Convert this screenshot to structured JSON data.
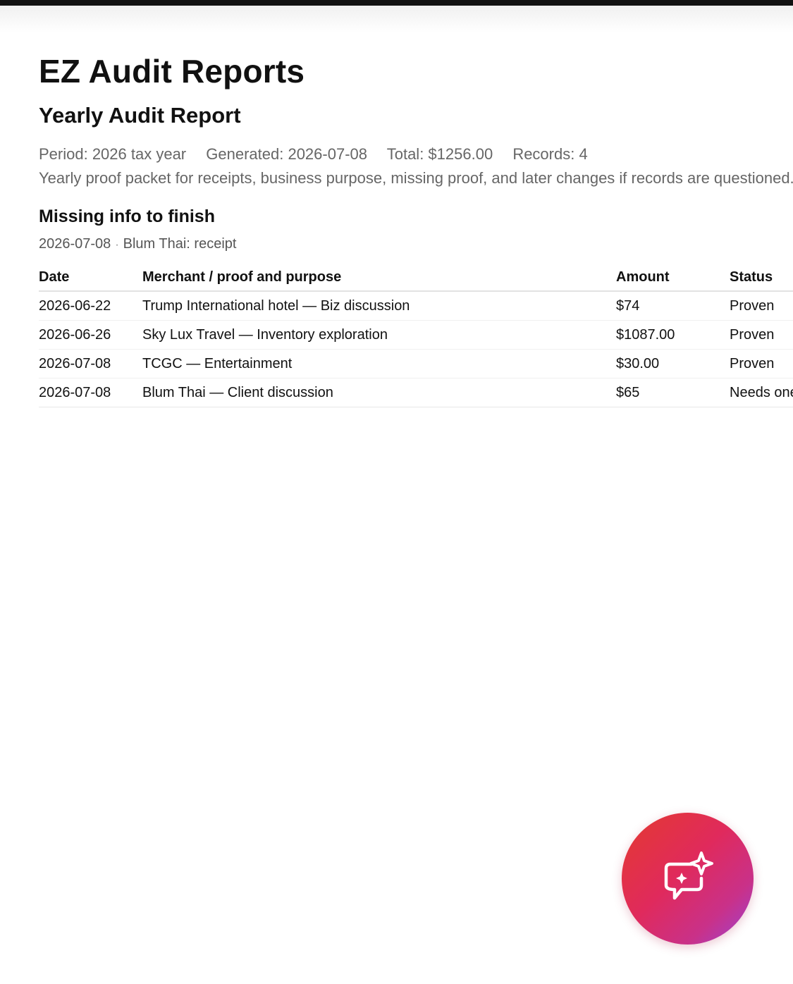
{
  "app": {
    "title": "EZ Audit Reports"
  },
  "report": {
    "title": "Yearly Audit Report",
    "period": "Period: 2026 tax year",
    "generated": "Generated: 2026-07-08",
    "total": "Total: $1256.00",
    "records": "Records: 4",
    "description": "Yearly proof packet for receipts, business purpose, missing proof, and later changes if records are questioned."
  },
  "missing": {
    "title": "Missing info to finish",
    "date": "2026-07-08",
    "separator": "·",
    "item": "Blum Thai: receipt"
  },
  "table": {
    "headers": {
      "date": "Date",
      "merchant": "Merchant / proof and purpose",
      "amount": "Amount",
      "status": "Status"
    },
    "rows": [
      {
        "date": "2026-06-22",
        "merchant": "Trump International hotel — Biz discussion",
        "amount": "$74",
        "status": "Proven"
      },
      {
        "date": "2026-06-26",
        "merchant": "Sky Lux Travel — Inventory exploration",
        "amount": "$1087.00",
        "status": "Proven"
      },
      {
        "date": "2026-07-08",
        "merchant": "TCGC — Entertainment",
        "amount": "$30.00",
        "status": "Proven"
      },
      {
        "date": "2026-07-08",
        "merchant": "Blum Thai — Client discussion",
        "amount": "$65",
        "status": "Needs one more proof"
      }
    ]
  },
  "fab": {
    "icon": "ai-chat-sparkle-icon",
    "gradient_start": "#e43a2f",
    "gradient_end": "#9a44d6"
  }
}
